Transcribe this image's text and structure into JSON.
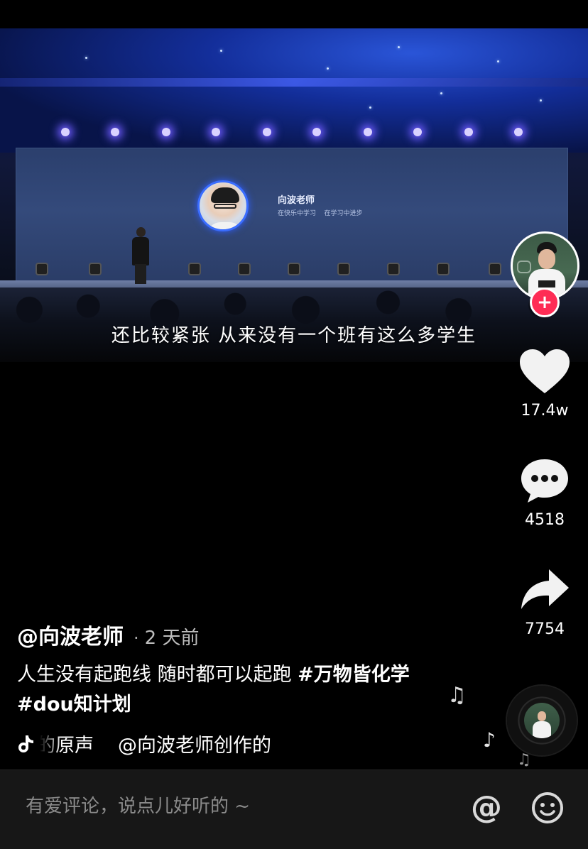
{
  "video": {
    "screen_title": "向波老师",
    "screen_subtitle": "在快乐中学习    在学习中进步",
    "subtitle": "还比较紧张  从来没有一个班有这么多学生"
  },
  "rail": {
    "follow_label": "+",
    "like_count": "17.4w",
    "comment_count": "4518",
    "share_count": "7754"
  },
  "post": {
    "author": "@向波老师",
    "separator": "·",
    "time": "2 天前",
    "caption_text": "人生没有起跑线  随时都可以起跑 ",
    "hashtags": [
      "#万物皆化学",
      "#dou知计划"
    ],
    "music_segments": [
      "师的原声",
      "@向波老师创作的"
    ]
  },
  "comment_bar": {
    "placeholder": "有爱评论，说点儿好听的 ~",
    "at_label": "@"
  },
  "colors": {
    "follow_red": "#fe2c55",
    "bar_bg": "#171717"
  },
  "icons": {
    "like": "heart-icon",
    "comment": "chat-bubble-icon",
    "share": "share-arrow-icon",
    "music": "tiktok-note-icon",
    "emoji": "smiley-icon"
  }
}
